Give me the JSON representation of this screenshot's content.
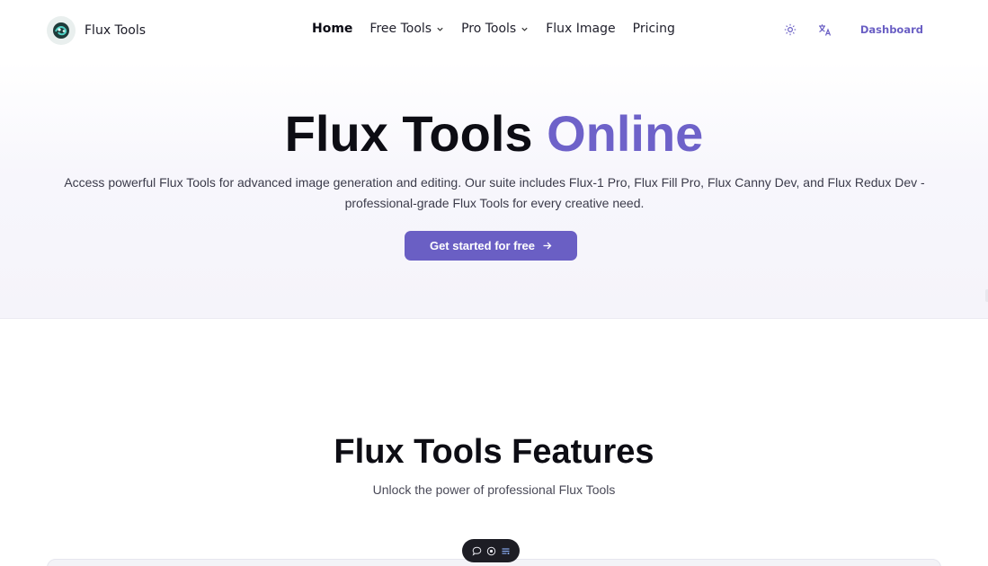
{
  "header": {
    "brand": "Flux Tools",
    "nav": [
      {
        "label": "Home",
        "active": true,
        "dropdown": false
      },
      {
        "label": "Free Tools",
        "active": false,
        "dropdown": true
      },
      {
        "label": "Pro Tools",
        "active": false,
        "dropdown": true
      },
      {
        "label": "Flux Image",
        "active": false,
        "dropdown": false
      },
      {
        "label": "Pricing",
        "active": false,
        "dropdown": false
      }
    ],
    "theme_icon": "sun-icon",
    "language_icon": "translate-icon",
    "dashboard_label": "Dashboard"
  },
  "hero": {
    "title_main": "Flux Tools",
    "title_accent": "Online",
    "description": "Access powerful Flux Tools for advanced image generation and editing. Our suite includes Flux-1 Pro, Flux Fill Pro, Flux Canny Dev, and Flux Redux Dev - professional-grade Flux Tools for every creative need.",
    "cta_label": "Get started for free",
    "cta_icon": "arrow-right-icon"
  },
  "features": {
    "title": "Flux Tools Features",
    "subtitle": "Unlock the power of professional Flux Tools"
  },
  "floating_toolbar": {
    "icons": [
      "comment-icon",
      "eye-icon",
      "list-icon"
    ]
  },
  "colors": {
    "accent": "#6e62c9",
    "button": "#6a5fc4",
    "text_dark": "#0d0d14",
    "toolbar_bg": "#1d1d24"
  }
}
